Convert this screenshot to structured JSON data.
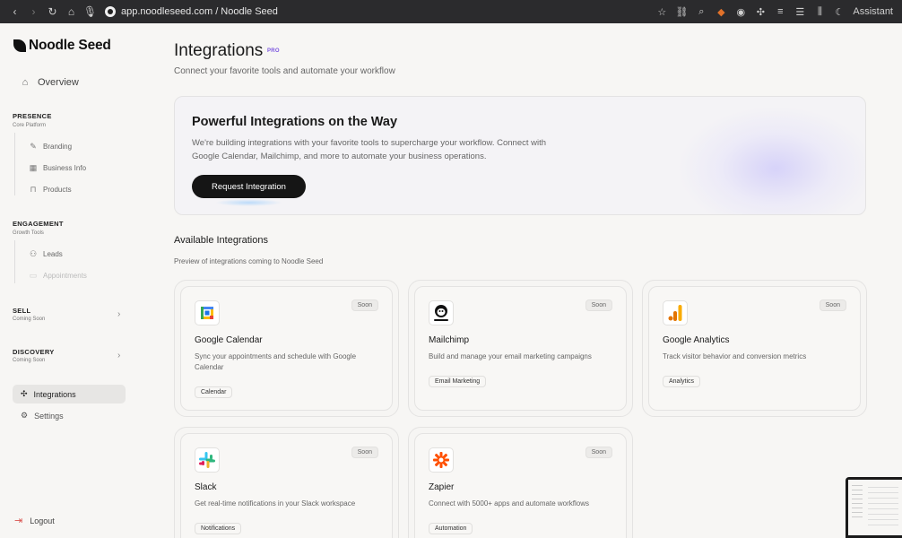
{
  "browser": {
    "url": "app.noodleseed.com / Noodle Seed",
    "assistant_label": "Assistant"
  },
  "sidebar": {
    "brand": "Noodle Seed",
    "overview": "Overview",
    "presence": {
      "title": "PRESENCE",
      "subtitle": "Core Platform",
      "items": [
        "Branding",
        "Business Info",
        "Products"
      ]
    },
    "engagement": {
      "title": "ENGAGEMENT",
      "subtitle": "Growth Tools",
      "items": [
        "Leads",
        "Appointments"
      ]
    },
    "sell": {
      "title": "SELL",
      "subtitle": "Coming Soon"
    },
    "discovery": {
      "title": "DISCOVERY",
      "subtitle": "Coming Soon"
    },
    "integrations": "Integrations",
    "settings": "Settings",
    "logout": "Logout"
  },
  "header": {
    "title": "Integrations",
    "badge": "PRO",
    "subtitle": "Connect your favorite tools and automate your workflow"
  },
  "hero": {
    "title": "Powerful Integrations on the Way",
    "text": "We're building integrations with your favorite tools to supercharge your workflow. Connect with Google Calendar, Mailchimp, and more to automate your business operations.",
    "button": "Request Integration"
  },
  "available": {
    "title": "Available Integrations",
    "subtitle": "Preview of integrations coming to Noodle Seed"
  },
  "cards": [
    {
      "name": "Google Calendar",
      "desc": "Sync your appointments and schedule with Google Calendar",
      "tag": "Calendar",
      "status": "Soon",
      "icon": "google-calendar-icon"
    },
    {
      "name": "Mailchimp",
      "desc": "Build and manage your email marketing campaigns",
      "tag": "Email Marketing",
      "status": "Soon",
      "icon": "mailchimp-icon"
    },
    {
      "name": "Google Analytics",
      "desc": "Track visitor behavior and conversion metrics",
      "tag": "Analytics",
      "status": "Soon",
      "icon": "google-analytics-icon"
    },
    {
      "name": "Slack",
      "desc": "Get real-time notifications in your Slack workspace",
      "tag": "Notifications",
      "status": "Soon",
      "icon": "slack-icon"
    },
    {
      "name": "Zapier",
      "desc": "Connect with 5000+ apps and automate workflows",
      "tag": "Automation",
      "status": "Soon",
      "icon": "zapier-icon"
    }
  ],
  "colors": {
    "accent_pro": "#7b55e0",
    "button_bg": "#151515",
    "logout_icon": "#d9534f"
  }
}
